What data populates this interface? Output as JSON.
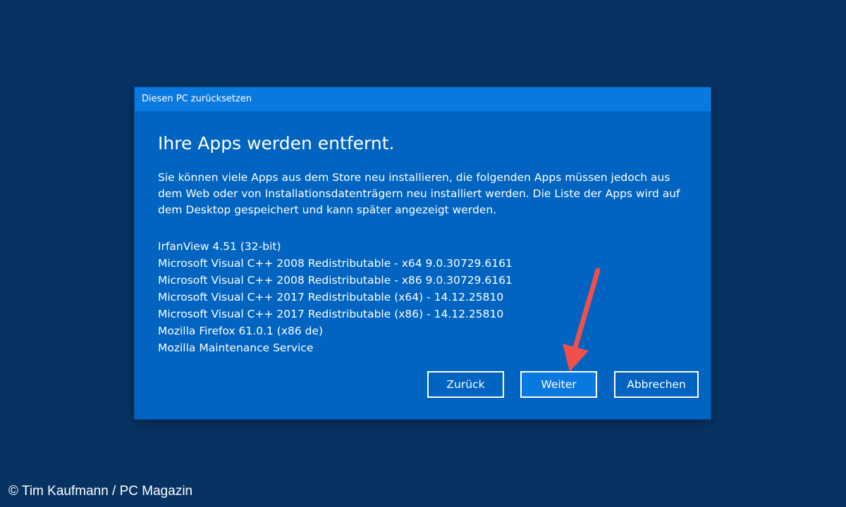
{
  "dialog": {
    "title": "Diesen PC zurücksetzen",
    "heading": "Ihre Apps werden entfernt.",
    "description": "Sie können viele Apps aus dem Store neu installieren, die folgenden Apps müssen jedoch aus dem Web oder von Installationsdatenträgern neu installiert werden. Die Liste der Apps wird auf dem Desktop gespeichert und kann später angezeigt werden.",
    "apps": [
      "IrfanView 4.51 (32-bit)",
      "Microsoft Visual C++ 2008 Redistributable - x64 9.0.30729.6161",
      "Microsoft Visual C++ 2008 Redistributable - x86 9.0.30729.6161",
      "Microsoft Visual C++ 2017 Redistributable (x64) - 14.12.25810",
      "Microsoft Visual C++ 2017 Redistributable (x86) - 14.12.25810",
      "Mozilla Firefox 61.0.1 (x86 de)",
      "Mozilla Maintenance Service"
    ],
    "buttons": {
      "back": "Zurück",
      "next": "Weiter",
      "cancel": "Abbrechen"
    }
  },
  "annotation": {
    "arrow_icon": "red-arrow-icon",
    "arrow_color": "#f0504a"
  },
  "copyright": "© Tim Kaufmann / PC Magazin",
  "colors": {
    "desktop_background": "#073363",
    "dialog_background": "#0064c0",
    "titlebar_background": "#0a79df",
    "text": "#ffffff"
  }
}
